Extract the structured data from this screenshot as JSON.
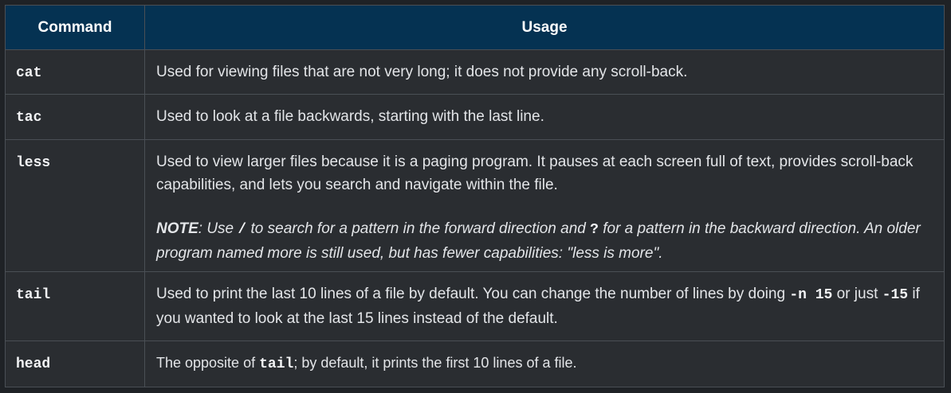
{
  "table": {
    "headers": {
      "command": "Command",
      "usage": "Usage"
    },
    "rows": [
      {
        "command": "cat",
        "usage": "Used for viewing files that are not very long; it does not provide any scroll-back."
      },
      {
        "command": "tac",
        "usage": "Used to look at a file backwards, starting with the last line."
      },
      {
        "command": "less",
        "usage": "Used to view larger files because it is a paging program. It pauses at each screen full of text, provides scroll-back capabilities, and lets you search and navigate within the file.",
        "note": {
          "label": "NOTE",
          "part1": ": Use ",
          "code1": "/",
          "part2": " to search for a pattern in the forward direction and ",
          "code2": "?",
          "part3": " for a pattern in the backward direction. An older program named more is still used, but has fewer capabilities: \"less is more\"."
        }
      },
      {
        "command": "tail",
        "usage_part1": "Used to print the last 10 lines of a file by default. You can change the number of lines by doing ",
        "code1": "-n 15",
        "usage_part2": " or just ",
        "code2": "-15",
        "usage_part3": " if you wanted to look at the last 15 lines instead of the default."
      },
      {
        "command": "head",
        "usage_part1": "The opposite of ",
        "code1": "tail",
        "usage_part2": "; by default, it prints the first 10 lines of a file."
      }
    ]
  }
}
